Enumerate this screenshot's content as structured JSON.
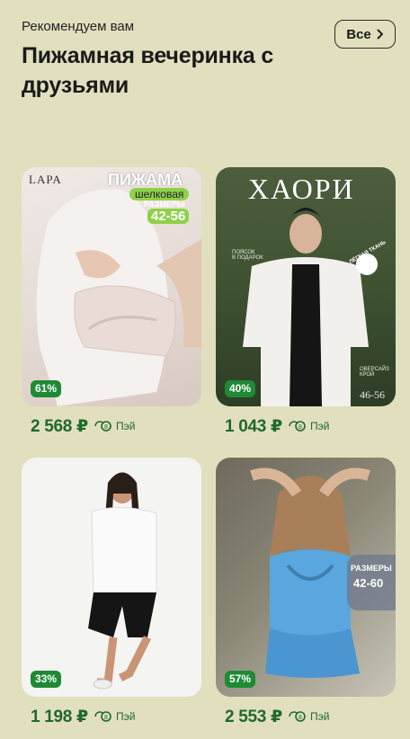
{
  "header": {
    "subtitle": "Рекомендуем вам",
    "title": "Пижамная вечеринка с друзьями",
    "all_label": "Все"
  },
  "products": [
    {
      "discount": "61%",
      "price": "2 568 ₽",
      "pay_label": "Пэй",
      "brand": "LAPA",
      "overlay_title": "ПИЖАМА",
      "overlay_tag": "шелковая",
      "overlay_sizes_label": "РАЗМЕРЫ",
      "overlay_sizes": "42-56"
    },
    {
      "discount": "40%",
      "price": "1 043 ₽",
      "pay_label": "Пэй",
      "overlay_title": "ХАОРИ",
      "overlay_sizes": "46-56",
      "overlay_left": "ПОЯСОК\nВ ПОДАРОК",
      "overlay_right": "ОВЕРСАЙЗ\nКРОЙ",
      "overlay_badge": "ЛЁГКАЯ ТКАНЬ"
    },
    {
      "discount": "33%",
      "price": "1 198 ₽",
      "pay_label": "Пэй"
    },
    {
      "discount": "57%",
      "price": "2 553 ₽",
      "pay_label": "Пэй",
      "overlay_sizes_label": "РАЗМЕРЫ",
      "overlay_sizes": "42-60"
    }
  ]
}
